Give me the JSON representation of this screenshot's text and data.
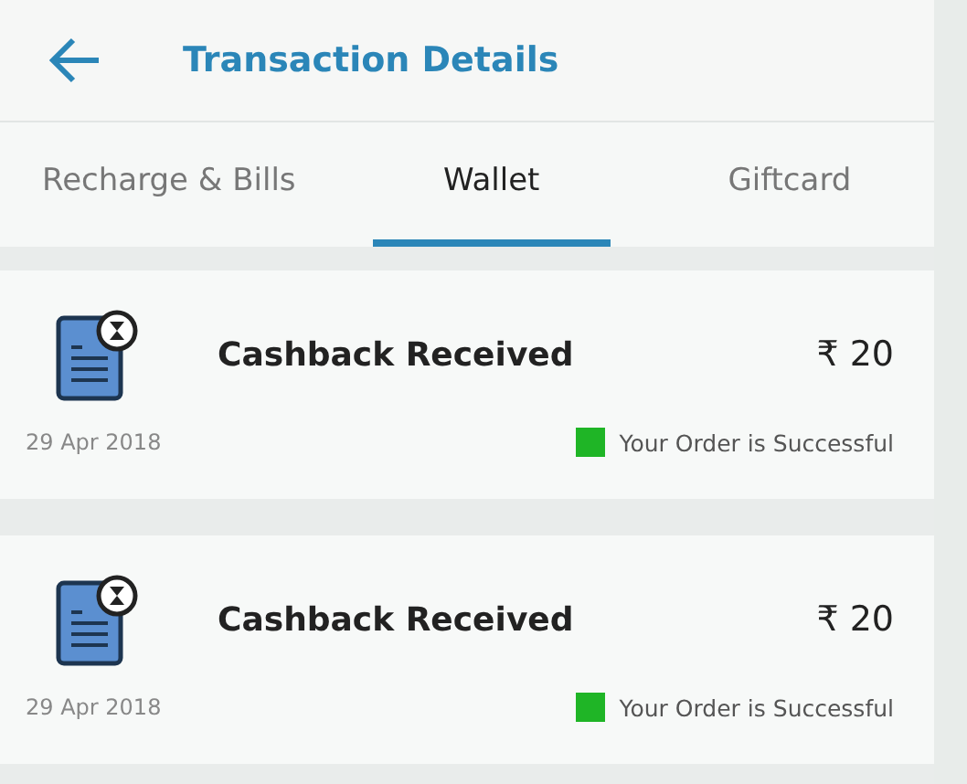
{
  "header": {
    "title": "Transaction Details"
  },
  "tabs": [
    {
      "label": "Recharge & Bills",
      "selected": false
    },
    {
      "label": "Wallet",
      "selected": true
    },
    {
      "label": "Giftcard",
      "selected": false
    }
  ],
  "transactions": [
    {
      "title": "Cashback Received",
      "amount": "₹ 20",
      "date": "29 Apr 2018",
      "status": "Your Order is Successful"
    },
    {
      "title": "Cashback Received",
      "amount": "₹ 20",
      "date": "29 Apr 2018",
      "status": "Your Order is Successful"
    }
  ]
}
